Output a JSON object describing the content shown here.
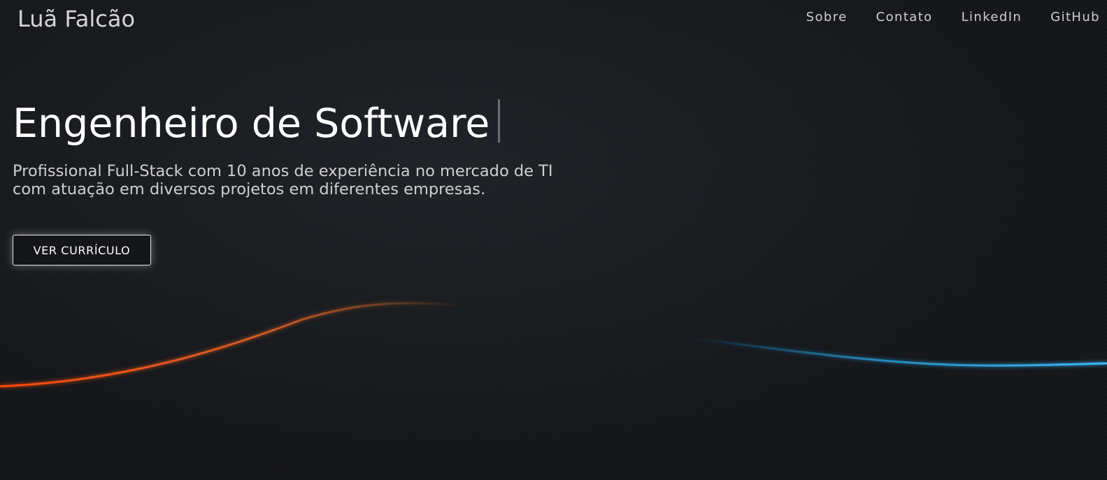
{
  "header": {
    "brand": "Luã Falcão",
    "nav": [
      {
        "label": "Sobre"
      },
      {
        "label": "Contato"
      },
      {
        "label": "LinkedIn"
      },
      {
        "label": "GitHub"
      }
    ]
  },
  "hero": {
    "headline": "Engenheiro de Software",
    "subtitle": "Profissional Full-Stack com 10 anos de experiência no mercado de TI com atuação em diversos projetos em diferentes empresas.",
    "cta_label": "VER CURRÍCULO"
  },
  "colors": {
    "background": "#15171b",
    "accent_orange": "#ff5a1a",
    "accent_blue": "#2aa7e6"
  }
}
